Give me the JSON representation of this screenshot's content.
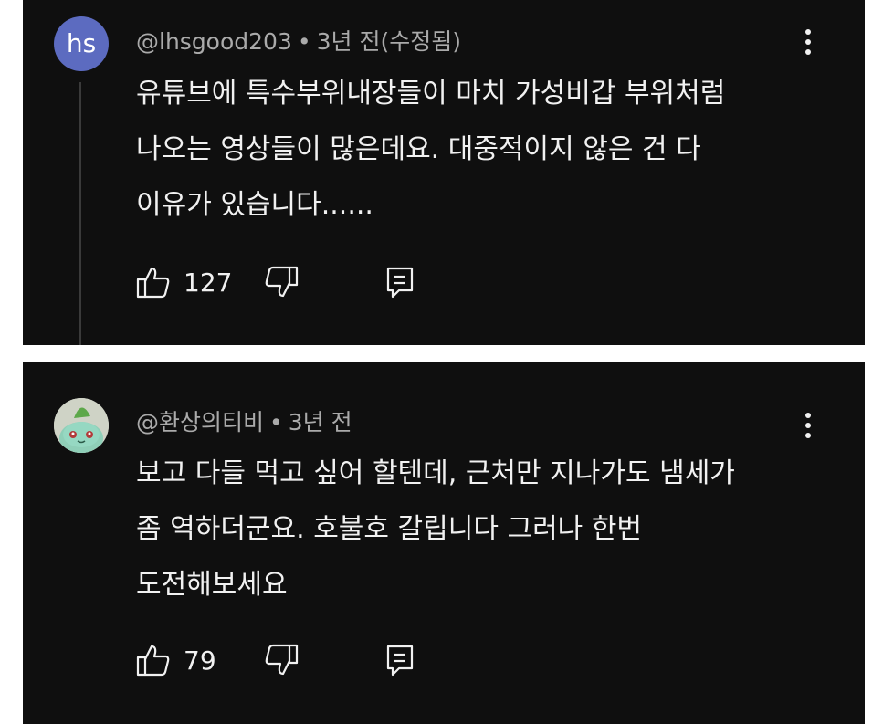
{
  "comments": [
    {
      "avatar_text": "hs",
      "avatar_color": "#5c6bc0",
      "author": "@lhsgood203",
      "separator": "•",
      "time": "3년 전(수정됨)",
      "lines": [
        "유튜브에 특수부위내장들이 마치 가성비갑 부위처럼",
        "나오는 영상들이 많은데요.  대중적이지 않은 건 다",
        "이유가 있습니다......"
      ],
      "likes": "127",
      "icons": {
        "like": "thumbs-up-icon",
        "dislike": "thumbs-down-icon",
        "reply": "reply-icon",
        "more": "more-vert-icon"
      }
    },
    {
      "avatar_image": "bulbasaur-avatar",
      "author": "@환상의티비",
      "separator": "•",
      "time": "3년 전",
      "lines": [
        "보고 다들 먹고 싶어 할텐데,  근처만 지나가도 냄세가",
        "좀 역하더군요. 호불호 갈립니다 그러나 한번",
        "도전해보세요"
      ],
      "likes": "79",
      "icons": {
        "like": "thumbs-up-icon",
        "dislike": "thumbs-down-icon",
        "reply": "reply-icon",
        "more": "more-vert-icon"
      }
    }
  ],
  "colors": {
    "background": "#0f0f0f",
    "text": "#f1f1f1",
    "meta": "#aaaaaa",
    "gap": "#ffffff"
  }
}
